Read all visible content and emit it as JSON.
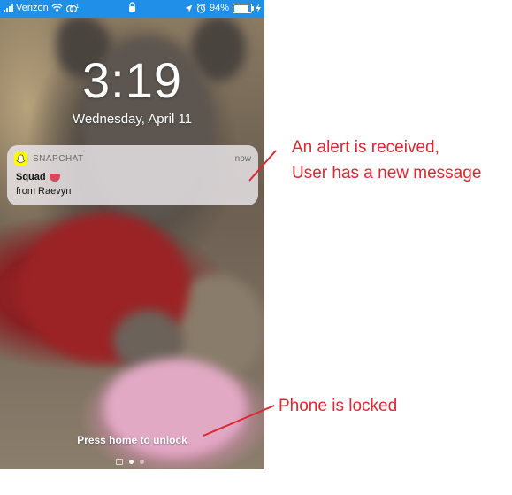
{
  "status_bar": {
    "carrier": "Verizon",
    "battery_percent": "94%",
    "battery_level": 0.94,
    "icons": [
      "signal-bars-icon",
      "wifi-icon",
      "hotspot-icon",
      "lock-icon",
      "location-icon",
      "alarm-icon",
      "charging-icon"
    ],
    "background_color": "#1f8fe8"
  },
  "lock_screen": {
    "time": "3:19",
    "date": "Wednesday, April 11",
    "unlock_hint": "Press home to unlock",
    "page_dots": [
      "camera",
      "active",
      "inactive"
    ]
  },
  "notification": {
    "app_name": "SNAPCHAT",
    "app_icon": "snapchat-ghost-icon",
    "app_color": "#fffc00",
    "timestamp": "now",
    "title": "Squad",
    "title_emoji": "tongue-emoji-icon",
    "body": "from Raevyn"
  },
  "annotations": {
    "alert_line1": "An alert is received,",
    "alert_line2": "User has a new message",
    "locked_text": "Phone is locked",
    "color": "#e0262e"
  }
}
